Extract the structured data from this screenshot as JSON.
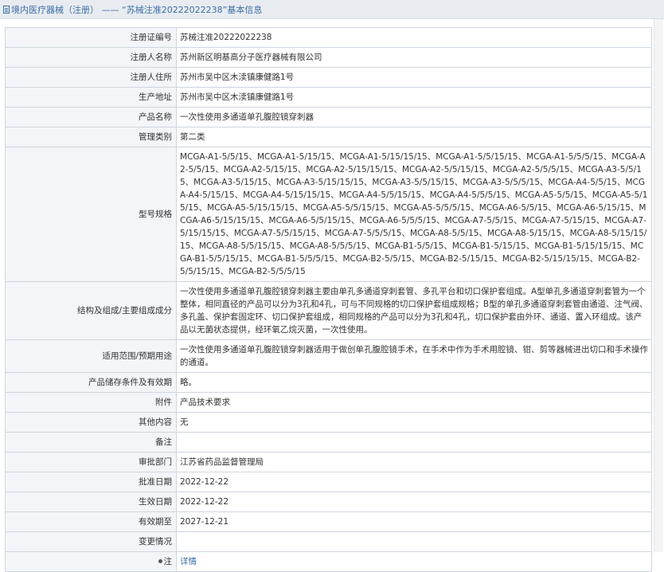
{
  "header": {
    "title": "境内医疗器械（注册） —— “苏械注准20222022238”基本信息"
  },
  "rows": [
    {
      "label": "注册证编号",
      "value": "苏械注准20222022238"
    },
    {
      "label": "注册人名称",
      "value": "苏州新区明基高分子医疗器械有限公司"
    },
    {
      "label": "注册人住所",
      "value": "苏州市吴中区木渎镇康健路1号"
    },
    {
      "label": "生产地址",
      "value": "苏州市吴中区木渎镇康健路1号"
    },
    {
      "label": "产品名称",
      "value": "一次性使用多通道单孔腹腔镜穿刺器"
    },
    {
      "label": "管理类别",
      "value": "第二类"
    },
    {
      "label": "型号规格",
      "value": "MCGA-A1-5/5/15、MCGA-A1-5/15/15、MCGA-A1-5/15/15/15、MCGA-A1-5/5/15/15、MCGA-A1-5/5/5/15、MCGA-A2-5/5/15、MCGA-A2-5/15/15、MCGA-A2-5/15/15/15、MCGA-A2-5/5/15/15、MCGA-A2-5/5/5/15、MCGA-A3-5/5/15、MCGA-A3-5/15/15、MCGA-A3-5/15/15/15、MCGA-A3-5/5/15/15、MCGA-A3-5/5/5/15、MCGA-A4-5/5/15、MCGA-A4-5/15/15、MCGA-A4-5/15/15/15、MCGA-A4-5/5/15/15、MCGA-A4-5/5/5/15、MCGA-A5-5/5/15、MCGA-A5-5/15/15、MCGA-A5-5/15/15/15、MCGA-A5-5/5/15/15、MCGA-A5-5/5/5/15、MCGA-A6-5/5/15、MCGA-A6-5/15/15、MCGA-A6-5/15/15/15、MCGA-A6-5/5/15/15、MCGA-A6-5/5/5/15、MCGA-A7-5/5/15、MCGA-A7-5/15/15、MCGA-A7-5/15/15/15、MCGA-A7-5/5/15/15、MCGA-A7-5/5/5/15、MCGA-A8-5/5/15、MCGA-A8-5/15/15、MCGA-A8-5/15/15/15、MCGA-A8-5/5/15/15、MCGA-A8-5/5/5/15、MCGA-B1-5/5/15、MCGA-B1-5/15/15、MCGA-B1-5/15/15/15、MCGA-B1-5/5/15/15、MCGA-B1-5/5/5/15、MCGA-B2-5/5/15、MCGA-B2-5/15/15、MCGA-B2-5/15/15/15、MCGA-B2-5/5/15/15、MCGA-B2-5/5/5/15"
    },
    {
      "label": "结构及组成/主要组成成分",
      "value": "一次性使用多通道单孔腹腔镜穿刺器主要由单孔多通道穿刺套管、多孔平台和切口保护套组成。A型单孔多通道穿刺套管为一个整体，相同直径的产品可以分为3孔和4孔，可与不同规格的切口保护套组成规格；B型的单孔多通道穿刺套管由通道、注气阀、多孔盖、保护套固定环、切口保护套组成，相同规格的产品可以分为3孔和4孔，切口保护套由外环、通道、置入环组成。该产品以无菌状态提供，经环氧乙烷灭菌，一次性使用。"
    },
    {
      "label": "适用范围/预期用途",
      "value": "一次性使用多通道单孔腹腔镜穿刺器适用于做创单孔腹腔镜手术，在手术中作为手术用腔镜、钳、剪等器械进出切口和手术操作的通道。"
    },
    {
      "label": "产品储存条件及有效期",
      "value": "略。"
    },
    {
      "label": "附件",
      "value": "产品技术要求"
    },
    {
      "label": "其他内容",
      "value": "无"
    },
    {
      "label": "备注",
      "value": ""
    },
    {
      "label": "审批部门",
      "value": "江苏省药品监督管理局"
    },
    {
      "label": "批准日期",
      "value": "2022-12-22"
    },
    {
      "label": "生效日期",
      "value": "2022-12-22"
    },
    {
      "label": "有效期至",
      "value": "2027-12-21"
    },
    {
      "label": "变更情况",
      "value": ""
    }
  ],
  "note_row": {
    "label": "注",
    "link": "详情",
    "icon": "pin-icon"
  }
}
